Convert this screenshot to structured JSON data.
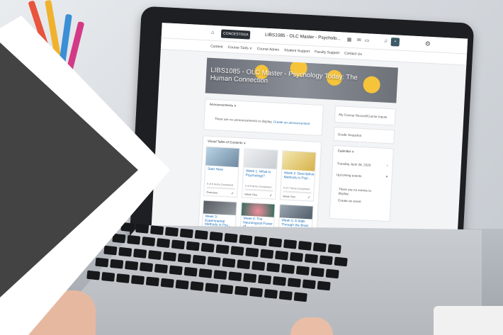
{
  "course": {
    "brand": "CONCESTOGA",
    "title": "LIBS1085 - OLC Master - Psycholo...",
    "banner_title": "LIBS1085 - OLC Master - Psychology Today: The Human Connection"
  },
  "subnav": [
    "Content",
    "Course Tools ∨",
    "Course Admin",
    "Student Support",
    "Faculty Support",
    "Contact Us"
  ],
  "announcements": {
    "header": "Announcements ∨",
    "empty": "There are no announcements to display.",
    "create_link": "Create an announcement"
  },
  "toc": {
    "header": "Visual Table of Contents ∨",
    "tiles": [
      {
        "title": "Start Here",
        "meta": "0 of 8 Items Completed",
        "overview": "Overview"
      },
      {
        "title": "Week 1: What Is Psychology?",
        "meta": "0 of 8 Items Completed",
        "overview": "Week One"
      },
      {
        "title": "Week 2: Descriptive Methods in Psyl...",
        "meta": "0 of 7 Items Completed",
        "overview": "Week Two"
      },
      {
        "title": "Week 3: Experimental Methods in Psy...",
        "meta": "",
        "overview": ""
      },
      {
        "title": "Week 4: The Neurological Power of...",
        "meta": "",
        "overview": ""
      },
      {
        "title": "Week 5: A Walk Through the Brain",
        "meta": "",
        "overview": ""
      }
    ]
  },
  "sidebar": {
    "recent": "My Course Record/Course Inputs",
    "grades": "Grade Snapshot",
    "calendar_header": "Calendar ∨",
    "calendar_date": "Tuesday, April 28, 2020",
    "upcoming": "Upcoming events",
    "no_events": "There are no events to display.",
    "create_event": "Create an event"
  },
  "colors": {
    "chevron": "#434343",
    "bezel": "#1d1f22",
    "link": "#1e6fb8",
    "emoji": "#f6c43a"
  }
}
